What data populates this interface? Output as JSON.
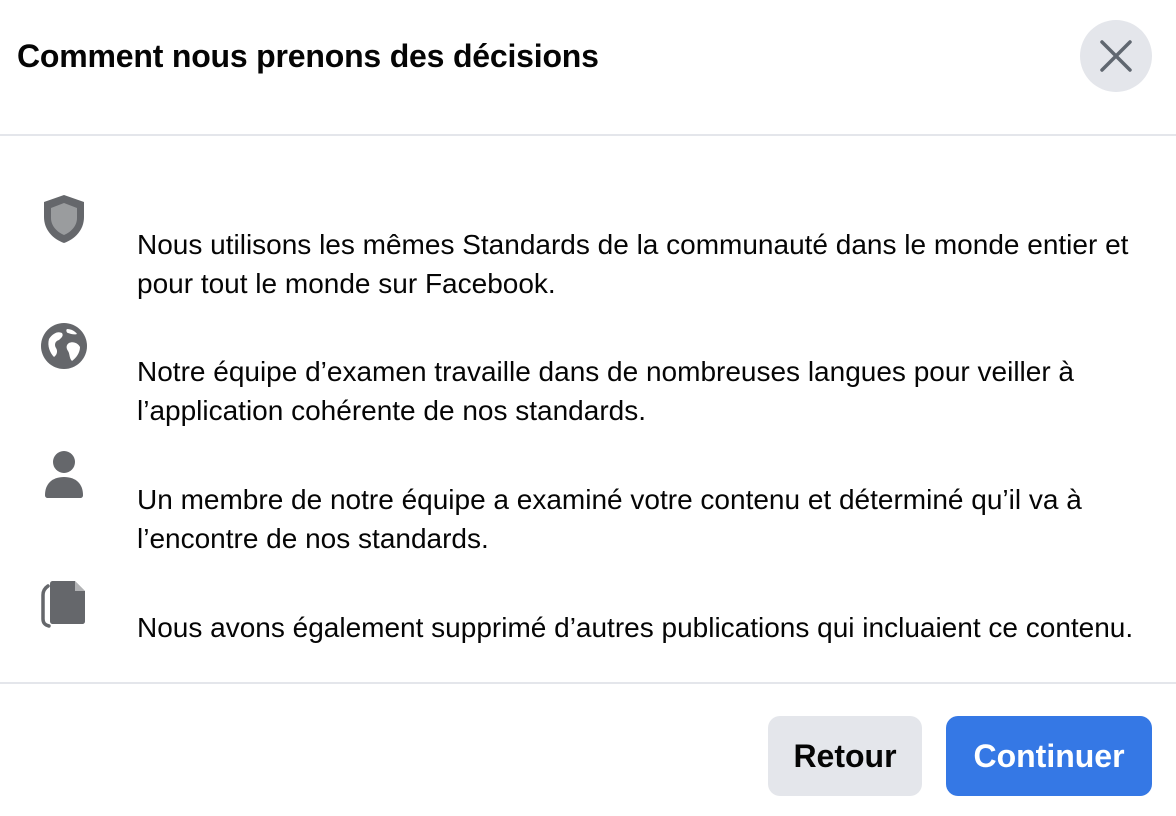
{
  "dialog": {
    "title": "Comment nous prenons des décisions",
    "close_icon": "close-icon"
  },
  "items": [
    {
      "icon": "shield-icon",
      "text": "Nous utilisons les mêmes Standards de la communauté dans le monde entier et pour tout le monde sur Facebook."
    },
    {
      "icon": "globe-icon",
      "text": "Notre équipe d’examen travaille dans de nombreuses langues pour veiller à l’application cohérente de nos standards."
    },
    {
      "icon": "person-icon",
      "text": "Un membre de notre équipe a examiné votre contenu et déterminé qu’il va à l’encontre de nos standards."
    },
    {
      "icon": "documents-icon",
      "text": "Nous avons également supprimé d’autres publications qui incluaient ce contenu."
    }
  ],
  "footer": {
    "back_label": "Retour",
    "continue_label": "Continuer"
  },
  "colors": {
    "primary": "#3578e5",
    "secondary_button": "#e4e6eb",
    "icon": "#65676b",
    "divider": "#e4e6eb"
  }
}
